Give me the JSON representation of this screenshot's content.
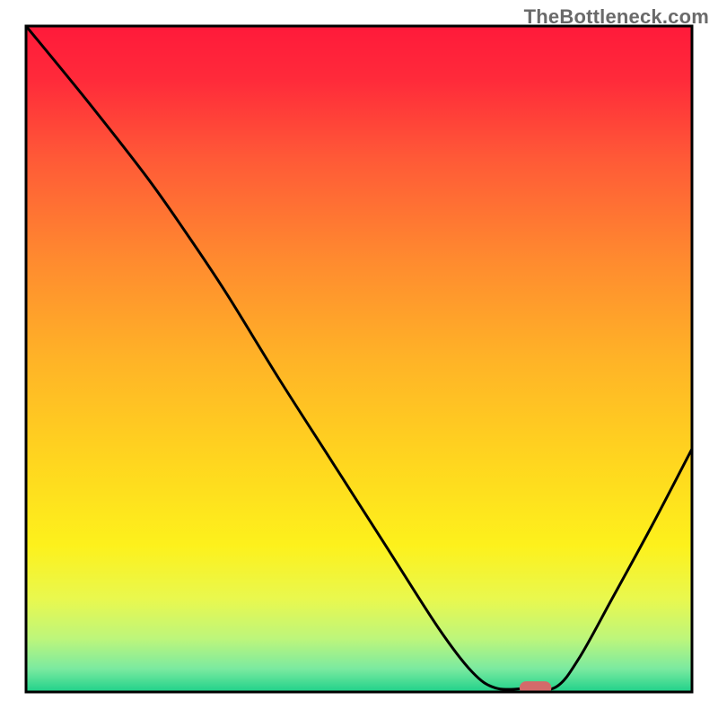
{
  "watermark": "TheBottleneck.com",
  "colors": {
    "border": "#000000",
    "curve": "#000000",
    "marker_fill": "#d46a6a",
    "gradient_stops": [
      {
        "offset": 0.0,
        "color": "#ff1a3a"
      },
      {
        "offset": 0.08,
        "color": "#ff2a3a"
      },
      {
        "offset": 0.2,
        "color": "#ff5a37"
      },
      {
        "offset": 0.35,
        "color": "#ff8a2f"
      },
      {
        "offset": 0.5,
        "color": "#ffb327"
      },
      {
        "offset": 0.65,
        "color": "#ffd51f"
      },
      {
        "offset": 0.78,
        "color": "#fdf11c"
      },
      {
        "offset": 0.86,
        "color": "#e9f84e"
      },
      {
        "offset": 0.92,
        "color": "#bdf67b"
      },
      {
        "offset": 0.965,
        "color": "#7beaa0"
      },
      {
        "offset": 1.0,
        "color": "#1fd18a"
      }
    ]
  },
  "plot": {
    "inner_x": 29,
    "inner_y": 29,
    "inner_w": 742,
    "inner_h": 742
  },
  "chart_data": {
    "type": "line",
    "title": "",
    "xlabel": "",
    "ylabel": "",
    "xlim": [
      0,
      100
    ],
    "ylim": [
      0,
      100
    ],
    "note": "Bottleneck-style curve. No axis ticks shown in image; x/y units unlabeled. Values below are read off as percentage of inner plot box (0 = left/bottom, 100 = right/top).",
    "series": [
      {
        "name": "bottleneck-curve",
        "points": [
          {
            "x": 0.0,
            "y": 100.0
          },
          {
            "x": 9.0,
            "y": 89.0
          },
          {
            "x": 18.0,
            "y": 77.5
          },
          {
            "x": 24.0,
            "y": 69.0
          },
          {
            "x": 30.0,
            "y": 60.0
          },
          {
            "x": 38.0,
            "y": 47.0
          },
          {
            "x": 46.0,
            "y": 34.5
          },
          {
            "x": 54.0,
            "y": 22.0
          },
          {
            "x": 62.0,
            "y": 9.5
          },
          {
            "x": 67.0,
            "y": 3.0
          },
          {
            "x": 70.5,
            "y": 0.6
          },
          {
            "x": 75.0,
            "y": 0.5
          },
          {
            "x": 79.5,
            "y": 0.7
          },
          {
            "x": 83.0,
            "y": 5.0
          },
          {
            "x": 88.0,
            "y": 14.0
          },
          {
            "x": 94.0,
            "y": 25.0
          },
          {
            "x": 100.0,
            "y": 36.5
          }
        ]
      }
    ],
    "marker": {
      "name": "optimal-point",
      "x": 76.5,
      "y": 0.6,
      "rx_pct": 2.4,
      "ry_pct": 1.0
    }
  }
}
